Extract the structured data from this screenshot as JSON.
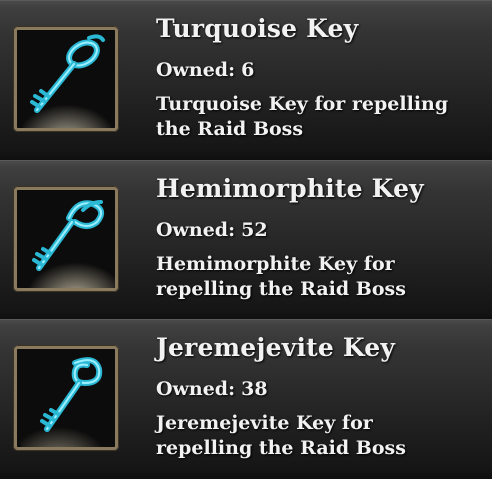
{
  "items": [
    {
      "name": "Turquoise Key",
      "owned_label": "Owned:",
      "owned_count": "6",
      "description_line1": "Turquoise Key for repelling",
      "description_line2": "the Raid Boss",
      "icon": "turquoise-key-icon"
    },
    {
      "name": "Hemimorphite Key",
      "owned_label": "Owned:",
      "owned_count": "52",
      "description_line1": "Hemimorphite Key for",
      "description_line2": "repelling the Raid Boss",
      "icon": "hemimorphite-key-icon"
    },
    {
      "name": "Jeremejevite Key",
      "owned_label": "Owned:",
      "owned_count": "38",
      "description_line1": "Jeremejevite Key for",
      "description_line2": "repelling the Raid Boss",
      "icon": "jeremejevite-key-icon"
    }
  ],
  "colors": {
    "key": "#3fd0e8",
    "key_highlight": "#a8f4ff",
    "frame": "#8a7a5e",
    "text": "#f2f2f2"
  }
}
